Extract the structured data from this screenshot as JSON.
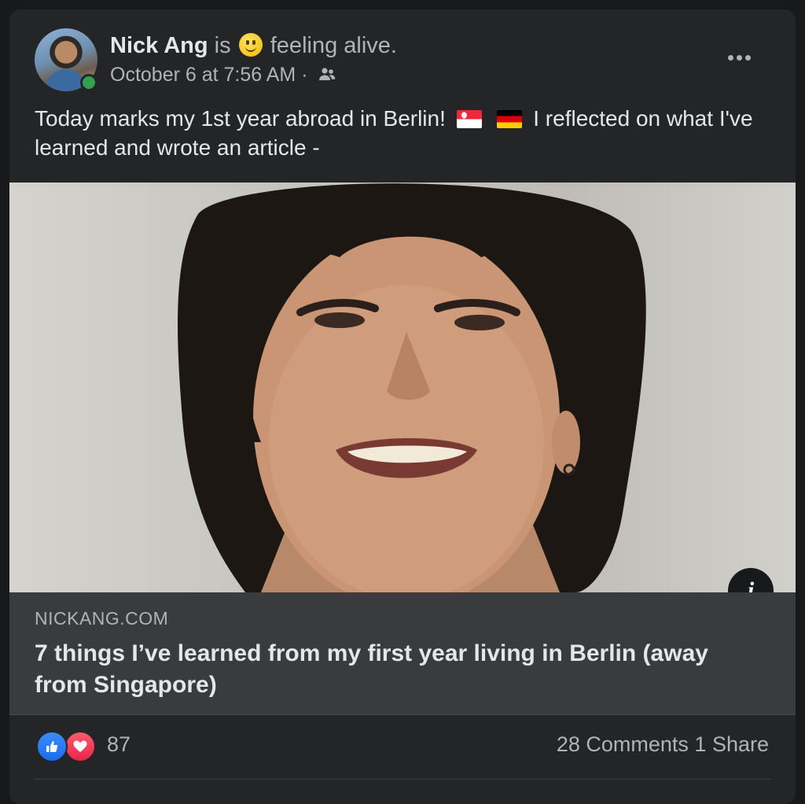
{
  "post": {
    "author": "Nick Ang",
    "feeling_prefix": "is",
    "feeling_text": "feeling alive.",
    "timestamp": "October 6 at 7:56 AM",
    "separator": "·",
    "audience_icon": "friends-icon",
    "text_part1": "Today marks my 1st year abroad in Berlin!",
    "text_part2": "I reflected on what I've learned and wrote an article -",
    "flags": [
      "singapore-flag",
      "germany-flag"
    ]
  },
  "link": {
    "domain": "NICKANG.COM",
    "title": "7 things I’ve learned from my first year living in Berlin (away from Singapore)",
    "info_label": "i"
  },
  "footer": {
    "reaction_icons": [
      "like-icon",
      "love-icon"
    ],
    "reaction_count": "87",
    "comments": "28 Comments",
    "shares": "1 Share"
  },
  "colors": {
    "background": "#18191a",
    "card": "#242526",
    "link_box": "#3a3b3c",
    "online": "#31a24c",
    "like": "#1a6cf0",
    "love": "#e8264a"
  }
}
